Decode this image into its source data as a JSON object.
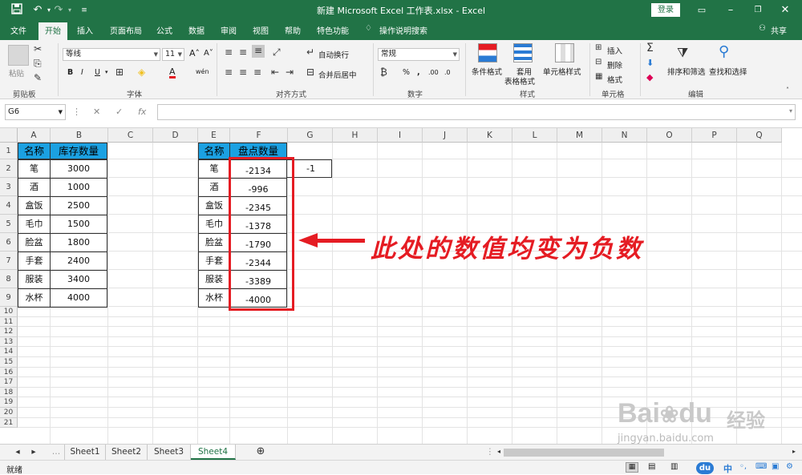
{
  "window": {
    "title": "新建 Microsoft Excel 工作表.xlsx  -  Excel",
    "login_label": "登录",
    "qat_save_icon": "save-icon",
    "qat_undo_icon": "undo-icon",
    "qat_redo_icon": "redo-icon"
  },
  "ribbon_tabs": [
    "文件",
    "开始",
    "插入",
    "页面布局",
    "公式",
    "数据",
    "审阅",
    "视图",
    "帮助",
    "特色功能",
    "操作说明搜索"
  ],
  "share_label": "共享",
  "ribbon": {
    "clipboard": {
      "paste": "粘贴",
      "label": "剪贴板"
    },
    "font": {
      "name": "等线",
      "size": "11",
      "label": "字体",
      "bold": "B",
      "italic": "I",
      "underline": "U"
    },
    "alignment": {
      "wrap": "自动换行",
      "merge": "合并后居中",
      "label": "对齐方式"
    },
    "number": {
      "format": "常规",
      "percent": "%",
      "label": "数字"
    },
    "styles": {
      "conditional": "条件格式",
      "table": "套用\n表格格式",
      "cell_styles": "单元格样式",
      "label": "样式"
    },
    "cells": {
      "insert": "插入",
      "delete": "删除",
      "format": "格式",
      "label": "单元格"
    },
    "editing": {
      "sort": "排序和筛选",
      "find": "查找和选择",
      "label": "编辑"
    }
  },
  "formula_bar": {
    "name_box": "G6",
    "fx": "fx",
    "cancel": "✕",
    "confirm": "✓"
  },
  "columns": [
    "A",
    "B",
    "C",
    "D",
    "E",
    "F",
    "G",
    "H",
    "I",
    "J",
    "K",
    "L",
    "M",
    "N",
    "O",
    "P",
    "Q"
  ],
  "rows": [
    "1",
    "2",
    "3",
    "4",
    "5",
    "6",
    "7",
    "8",
    "9",
    "10",
    "11",
    "12",
    "13",
    "14",
    "15",
    "16",
    "17",
    "18",
    "19",
    "20",
    "21"
  ],
  "table1": {
    "header": [
      "名称",
      "库存数量"
    ],
    "rows": [
      [
        "笔",
        "3000"
      ],
      [
        "酒",
        "1000"
      ],
      [
        "盒饭",
        "2500"
      ],
      [
        "毛巾",
        "1500"
      ],
      [
        "脸盆",
        "1800"
      ],
      [
        "手套",
        "2400"
      ],
      [
        "服装",
        "3400"
      ],
      [
        "水杯",
        "4000"
      ]
    ]
  },
  "table2": {
    "header": [
      "名称",
      "盘点数量"
    ],
    "rows": [
      [
        "笔",
        "-2134"
      ],
      [
        "酒",
        "-996"
      ],
      [
        "盒饭",
        "-2345"
      ],
      [
        "毛巾",
        "-1378"
      ],
      [
        "脸盆",
        "-1790"
      ],
      [
        "手套",
        "-2344"
      ],
      [
        "服装",
        "-3389"
      ],
      [
        "水杯",
        "-4000"
      ]
    ]
  },
  "g2_value": "-1",
  "annotation": "此处的数值均变为负数",
  "sheets": [
    "Sheet1",
    "Sheet2",
    "Sheet3",
    "Sheet4"
  ],
  "active_sheet": "Sheet4",
  "status": {
    "ready": "就绪",
    "ime": "中"
  },
  "watermark": {
    "brand": "Bai",
    "brand2": "du",
    "cn": "经验",
    "url": "jingyan.baidu.com"
  },
  "colors": {
    "accent": "#217346",
    "header_fill": "#1ba1e2",
    "highlight": "#e51c23"
  }
}
